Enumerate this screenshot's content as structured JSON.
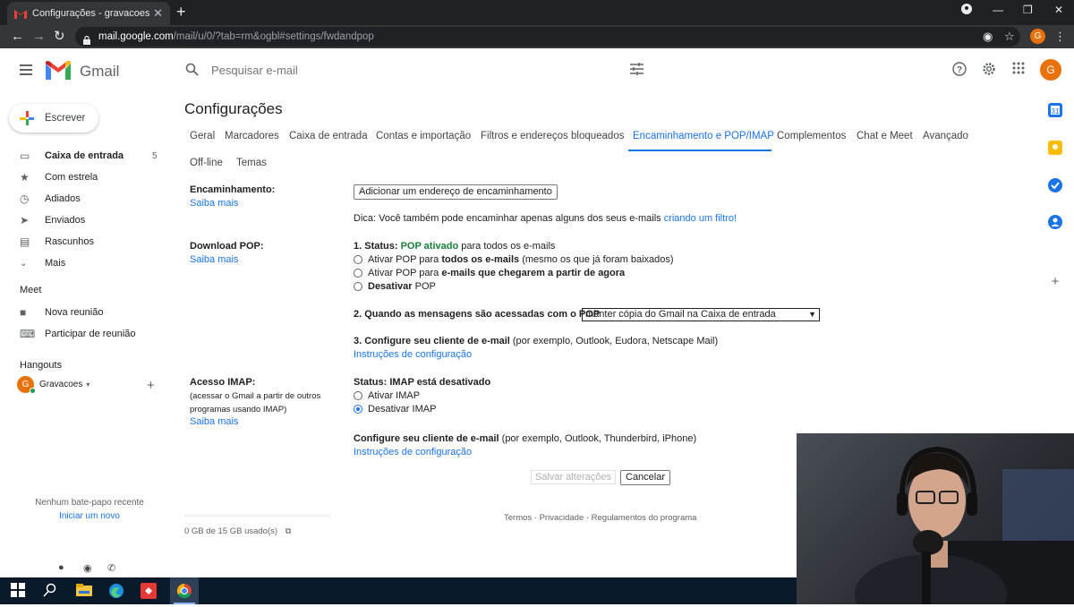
{
  "browser": {
    "tab_title": "Configurações - gravacoesphsbr...",
    "url_host": "mail.google.com",
    "url_path": "/mail/u/0/?tab=rm&ogbl#settings/fwdandpop",
    "avatar_letter": "G"
  },
  "header": {
    "app_name": "Gmail",
    "search_placeholder": "Pesquisar e-mail",
    "avatar_letter": "G"
  },
  "sidebar": {
    "compose_label": "Escrever",
    "items": [
      {
        "label": "Caixa de entrada",
        "count": "5",
        "icon": "inbox-icon"
      },
      {
        "label": "Com estrela",
        "count": "",
        "icon": "star-icon"
      },
      {
        "label": "Adiados",
        "count": "",
        "icon": "clock-icon"
      },
      {
        "label": "Enviados",
        "count": "",
        "icon": "send-icon"
      },
      {
        "label": "Rascunhos",
        "count": "",
        "icon": "draft-icon"
      },
      {
        "label": "Mais",
        "count": "",
        "icon": "chevron-down-icon"
      }
    ],
    "meet_title": "Meet",
    "meet_items": [
      {
        "label": "Nova reunião",
        "icon": "video-icon"
      },
      {
        "label": "Participar de reunião",
        "icon": "keyboard-icon"
      }
    ],
    "hangouts_title": "Hangouts",
    "hangouts_user": "Gravacoes",
    "hangouts_avatar": "G",
    "no_chat": "Nenhum bate-papo recente",
    "start_new": "Iniciar um novo"
  },
  "settings": {
    "title": "Configurações",
    "tabs_row1": [
      "Geral",
      "Marcadores",
      "Caixa de entrada",
      "Contas e importação",
      "Filtros e endereços bloqueados",
      "Encaminhamento e POP/IMAP",
      "Complementos",
      "Chat e Meet",
      "Avançado"
    ],
    "tabs_row2": [
      "Off-line",
      "Temas"
    ],
    "active_tab": "Encaminhamento e POP/IMAP",
    "forwarding": {
      "label": "Encaminhamento:",
      "learn_more": "Saiba mais",
      "add_button": "Adicionar um endereço de encaminhamento",
      "tip_prefix": "Dica: Você também pode encaminhar apenas alguns dos seus e-mails",
      "tip_link": "criando um filtro!"
    },
    "pop": {
      "label": "Download POP:",
      "learn_more": "Saiba mais",
      "status_prefix": "1. Status:",
      "status_value": "POP ativado",
      "status_suffix": "para todos os e-mails",
      "option1_pre": "Ativar POP para",
      "option1_bold": "todos os e-mails",
      "option1_post": "(mesmo os que já foram baixados)",
      "option2_pre": "Ativar POP para",
      "option2_bold": "e-mails que chegarem a partir de agora",
      "option3_bold": "Desativar",
      "option3_post": "POP",
      "when_label": "2. Quando as mensagens são acessadas com o POP",
      "when_value": "manter cópia do Gmail na Caixa de entrada",
      "configure_bold": "3. Configure seu cliente de e-mail",
      "configure_rest": "(por exemplo, Outlook, Eudora, Netscape Mail)",
      "instructions": "Instruções de configuração"
    },
    "imap": {
      "label": "Acesso IMAP:",
      "desc": "(acessar o Gmail a partir de outros programas usando IMAP)",
      "learn_more": "Saiba mais",
      "status": "Status: IMAP está desativado",
      "enable": "Ativar IMAP",
      "disable": "Desativar IMAP",
      "selected": "Desativar IMAP",
      "configure_bold": "Configure seu cliente de e-mail",
      "configure_rest": "(por exemplo, Outlook, Thunderbird, iPhone)",
      "instructions": "Instruções de configuração"
    },
    "save_label": "Salvar alterações",
    "cancel_label": "Cancelar",
    "storage": "0 GB de 15 GB usado(s)",
    "footer": "Termos · Privacidade · Regulamentos do programa"
  },
  "colors": {
    "accent": "#1a73e8",
    "pop_enabled": "#188038",
    "avatar": "#e8710a",
    "taskbar": "#0b1a2a"
  }
}
